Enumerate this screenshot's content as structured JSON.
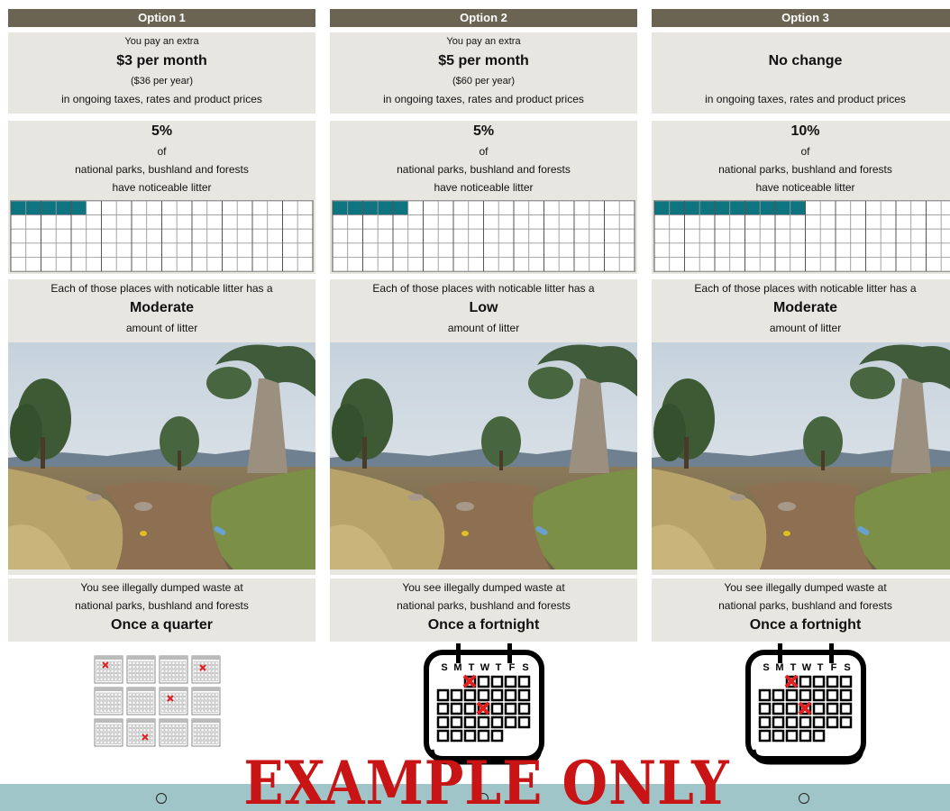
{
  "options": [
    {
      "header": "Option 1",
      "cost_prefix": "You pay an extra",
      "cost_amount": "$3 per month",
      "cost_year": "($36 per year)",
      "cost_suffix": "in ongoing taxes, rates and product prices",
      "litter_percent": "5%",
      "litter_of": "of",
      "litter_places": "national parks, bushland and forests",
      "litter_suffix": "have noticeable litter",
      "litter_fraction": 0.05,
      "amount_prefix": "Each of those places with noticable litter has a",
      "amount_level": "Moderate",
      "amount_suffix": "amount of litter",
      "dump_line1": "You see illegally dumped waste at",
      "dump_line2": "national parks, bushland and forests",
      "dump_frequency": "Once a quarter"
    },
    {
      "header": "Option 2",
      "cost_prefix": "You pay an extra",
      "cost_amount": "$5 per month",
      "cost_year": "($60 per year)",
      "cost_suffix": "in ongoing taxes, rates and product prices",
      "litter_percent": "5%",
      "litter_of": "of",
      "litter_places": "national parks, bushland and forests",
      "litter_suffix": "have noticeable litter",
      "litter_fraction": 0.05,
      "amount_prefix": "Each of those places with noticable litter has a",
      "amount_level": "Low",
      "amount_suffix": "amount of litter",
      "dump_line1": "You see illegally dumped waste at",
      "dump_line2": "national parks, bushland and forests",
      "dump_frequency": "Once a fortnight"
    },
    {
      "header": "Option 3",
      "cost_prefix": "",
      "cost_amount": "No change",
      "cost_year": "",
      "cost_suffix": "in ongoing taxes, rates and product prices",
      "litter_percent": "10%",
      "litter_of": "of",
      "litter_places": "national parks, bushland and forests",
      "litter_suffix": "have noticeable litter",
      "litter_fraction": 0.1,
      "amount_prefix": "Each of those places with noticable litter has a",
      "amount_level": "Moderate",
      "amount_suffix": "amount of litter",
      "dump_line1": "You see illegally dumped waste at",
      "dump_line2": "national parks, bushland and forests",
      "dump_frequency": "Once a fortnight"
    }
  ],
  "calendar_days": [
    "S",
    "M",
    "T",
    "W",
    "T",
    "F",
    "S"
  ],
  "watermark": "EXAMPLE ONLY",
  "colors": {
    "header_bg": "#6b6453",
    "band_bg": "#e8e6e1",
    "grid_fill": "#0e7480",
    "radio_bar": "#9fc5c8",
    "watermark": "#c81414",
    "mark": "#e02020"
  },
  "icons": [
    "grid-icon",
    "landscape-photo",
    "quarterly-calendars-icon",
    "fortnight-calendar-icon",
    "radio-button"
  ]
}
